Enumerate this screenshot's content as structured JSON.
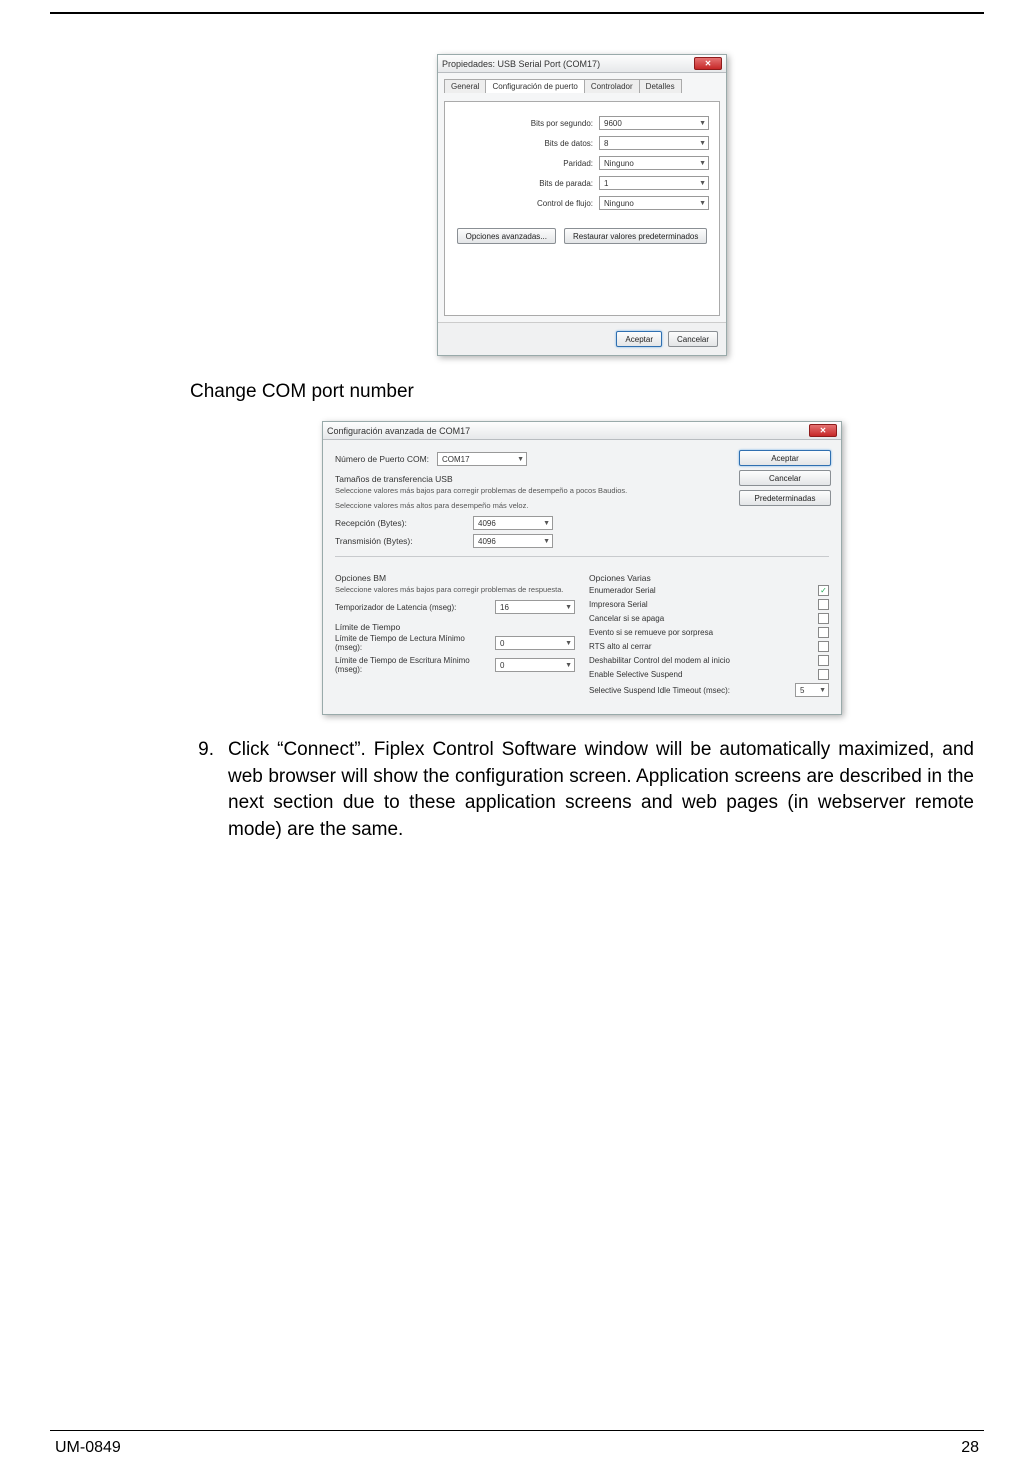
{
  "dlg1": {
    "title": "Propiedades: USB Serial Port (COM17)",
    "tabs": [
      "General",
      "Configuración de puerto",
      "Controlador",
      "Detalles"
    ],
    "active_tab_index": 1,
    "fields": {
      "bps_label": "Bits por segundo:",
      "bps_value": "9600",
      "databits_label": "Bits de datos:",
      "databits_value": "8",
      "parity_label": "Paridad:",
      "parity_value": "Ninguno",
      "stopbits_label": "Bits de parada:",
      "stopbits_value": "1",
      "flow_label": "Control de flujo:",
      "flow_value": "Ninguno"
    },
    "advanced_btn": "Opciones avanzadas...",
    "restore_btn": "Restaurar valores predeterminados",
    "ok_btn": "Aceptar",
    "cancel_btn": "Cancelar"
  },
  "caption1": "Change COM port number",
  "dlg2": {
    "title": "Configuración avanzada de COM17",
    "com_label": "Número de Puerto COM:",
    "com_value": "COM17",
    "ok": "Aceptar",
    "cancel": "Cancelar",
    "defaults": "Predeterminadas",
    "usb_title": "Tamaños de transferencia USB",
    "usb_hint1": "Seleccione valores más bajos para corregir problemas de desempeño a pocos Baudios.",
    "usb_hint2": "Seleccione valores más altos para desempeño más veloz.",
    "rx_label": "Recepción (Bytes):",
    "rx_value": "4096",
    "tx_label": "Transmisión (Bytes):",
    "tx_value": "4096",
    "bm_title": "Opciones BM",
    "bm_hint": "Seleccione valores más bajos para corregir problemas de respuesta.",
    "latency_label": "Temporizador de Latencia (mseg):",
    "latency_value": "16",
    "timeouts_title": "Límite de Tiempo",
    "read_to_label": "Límite de Tiempo de Lectura Mínimo (mseg):",
    "read_to_value": "0",
    "write_to_label": "Límite de Tiempo de Escritura Mínimo (mseg):",
    "write_to_value": "0",
    "misc_title": "Opciones Varias",
    "misc": {
      "enum": "Enumerador Serial",
      "printer": "Impresora Serial",
      "cancel_off": "Cancelar si se apaga",
      "surprise": "Evento si se remueve por sorpresa",
      "rts": "RTS alto al cerrar",
      "modem": "Deshabilitar Control del modem al inicio",
      "suspend": "Enable Selective Suspend",
      "idle_label": "Selective Suspend Idle Timeout (msec):",
      "idle_value": "5"
    }
  },
  "step9": {
    "num": "9.",
    "text": "Click “Connect”.  Fiplex Control Software window will be automatically maximized, and web browser will show the configuration screen. Application screens are described in the next section due to these application screens and web pages (in webserver remote mode) are the same."
  },
  "footer": {
    "doc": "UM-0849",
    "page": "28"
  }
}
